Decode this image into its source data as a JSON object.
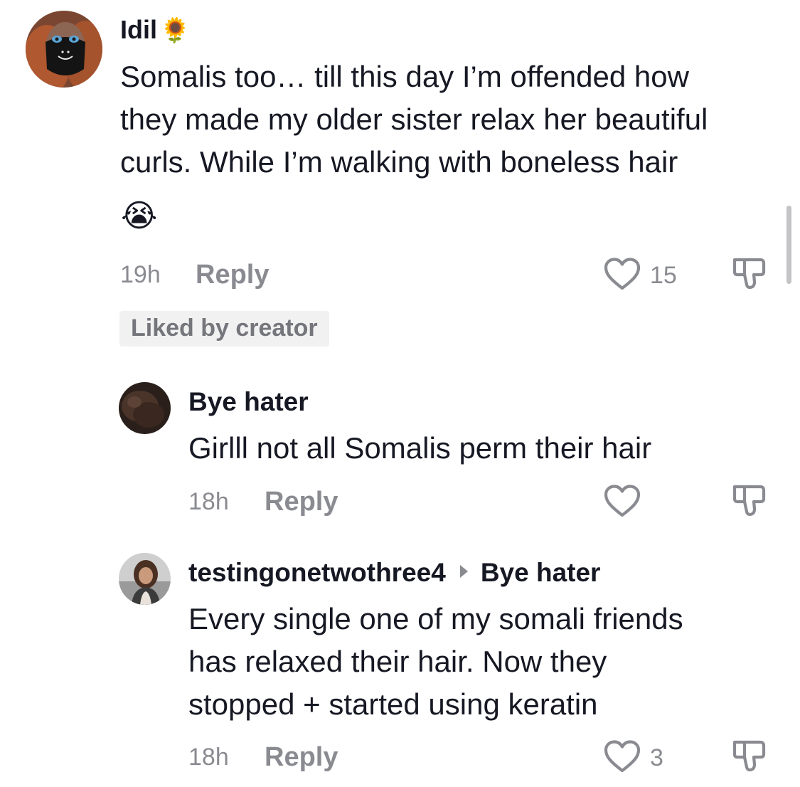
{
  "comments": [
    {
      "username": "Idil",
      "username_emoji": "🌻",
      "text_lines": [
        "Somalis too… till this day I’m offended how",
        "they made my older sister relax her beautiful",
        "curls. While I’m walking with boneless hair"
      ],
      "text_emoji": "😭",
      "time": "19h",
      "reply_label": "Reply",
      "like_count": "15",
      "badge": "Liked by creator"
    },
    {
      "username": "Bye hater",
      "text_lines": [
        "Girlll not all Somalis perm their hair"
      ],
      "time": "18h",
      "reply_label": "Reply",
      "like_count": ""
    },
    {
      "username": "testingonetwothree4",
      "reply_to": "Bye hater",
      "text_lines": [
        "Every single one of my somali friends",
        "has relaxed their hair. Now they",
        "stopped + started using keratin"
      ],
      "time": "18h",
      "reply_label": "Reply",
      "like_count": "3"
    }
  ],
  "icons": {
    "like": "heart-outline-icon",
    "dislike": "thumbs-down-icon",
    "reply_to_arrow": "triangle-right-icon"
  },
  "colors": {
    "text_primary": "#161823",
    "text_secondary": "#8a8b91",
    "badge_bg": "#f1f1f2",
    "badge_text": "#75767c"
  }
}
